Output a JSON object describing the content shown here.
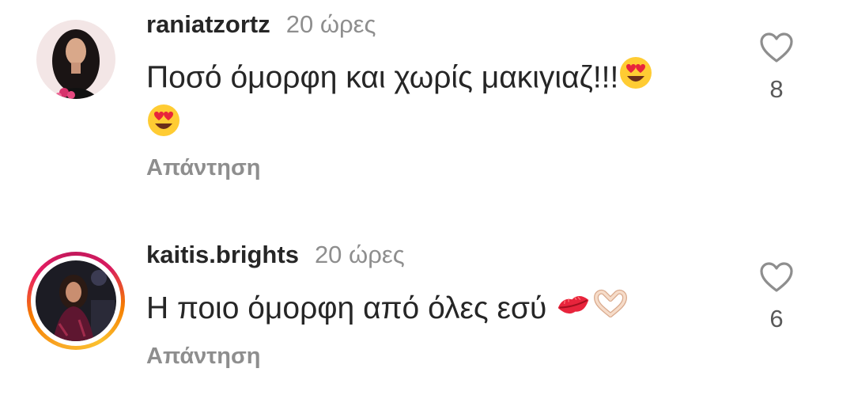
{
  "comments": [
    {
      "username": "raniatzortz",
      "time": "20 ώρες",
      "text": "Ποσό όμορφη και χωρίς μακιγιαζ!!!",
      "emojis": [
        "heart-eyes-emoji",
        "heart-eyes-emoji"
      ],
      "reply_label": "Απάντηση",
      "like_count": "8",
      "has_story_ring": false
    },
    {
      "username": "kaitis.brights",
      "time": "20 ώρες",
      "text": "Η ποιο όμορφη από όλες εσύ",
      "emojis": [
        "kiss-lips-emoji",
        "heart-hands-emoji"
      ],
      "reply_label": "Απάντηση",
      "like_count": "6",
      "has_story_ring": true
    }
  ],
  "colors": {
    "primary_text": "#262626",
    "secondary_text": "#8e8e8e",
    "like_count": "#595959",
    "heart_outline": "#8e8e8e",
    "background": "#ffffff"
  }
}
